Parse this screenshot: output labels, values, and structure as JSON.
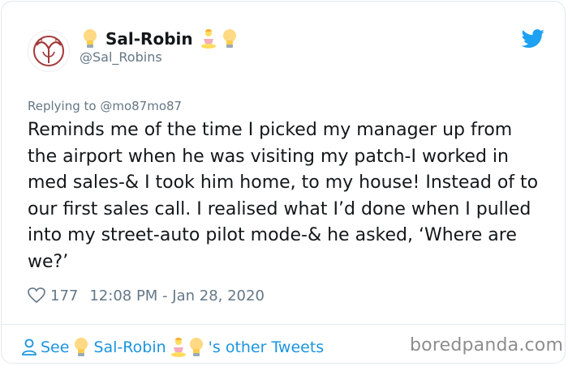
{
  "user": {
    "display_name": "Sal-Robin",
    "handle": "@Sal_Robins"
  },
  "tweet": {
    "replying_to": "Replying to @mo87mo87",
    "text": "Reminds me of the time I picked my manager up from the airport when he was visiting my patch-I worked in med sales-& I took him home, to my house! Instead of to our first sales call. I realised what I’d done when I pulled into my street-auto pilot mode-& he asked, ‘Where are we?’",
    "likes": "177",
    "timestamp": "12:08 PM - Jan 28, 2020"
  },
  "footer": {
    "see_label": "See",
    "name": "Sal-Robin",
    "suffix": "'s other Tweets"
  },
  "watermark": "boredpanda.com",
  "colors": {
    "link_blue": "#1b95e0",
    "twitter_blue": "#1da1f2",
    "secondary_text": "#657786",
    "avatar_red": "#a33a3a"
  },
  "icons": {
    "avatar": "ornamental-logo-avatar",
    "name_emoji_left": "lightbulb-icon",
    "name_emoji_right_1": "person-in-lotus-position-icon",
    "name_emoji_right_2": "lightbulb-icon",
    "brand": "twitter-bird-icon",
    "like": "heart-outline-icon",
    "profile": "person-outline-icon"
  }
}
